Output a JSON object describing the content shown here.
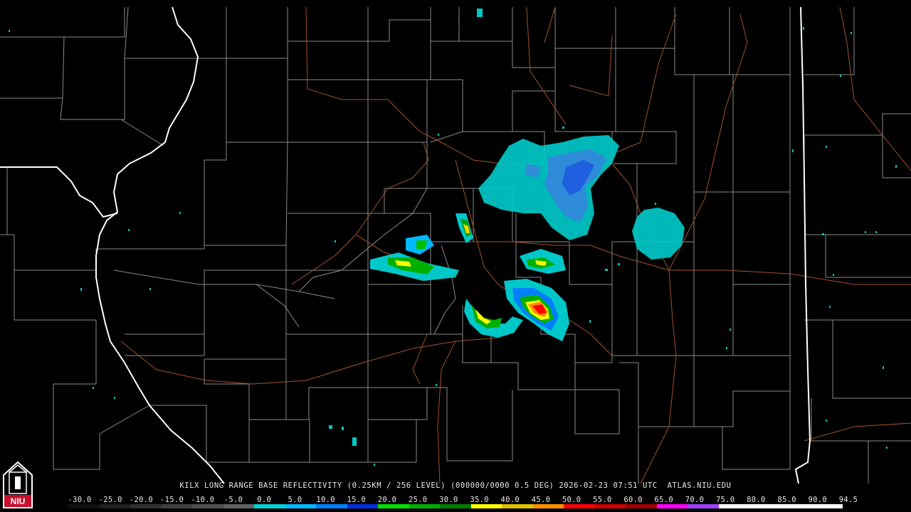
{
  "caption": "KILX LONG RANGE BASE REFLECTIVITY (0.25KM / 256 LEVEL) (000000/0000 0.5 DEG) 2026-02-23 07:51 UTC  ATLAS.NIU.EDU",
  "logo_text": "NIU",
  "scale": {
    "labels": [
      "-30.0",
      "-25.0",
      "-20.0",
      "-15.0",
      "-10.0",
      "-5.0",
      "0.0",
      "5.0",
      "10.0",
      "15.0",
      "20.0",
      "25.0",
      "30.0",
      "35.0",
      "40.0",
      "45.0",
      "50.0",
      "55.0",
      "60.0",
      "65.0",
      "70.0",
      "75.0",
      "80.0",
      "85.0",
      "90.0",
      "94.5"
    ],
    "colors": [
      "#101010",
      "#202020",
      "#303030",
      "#404040",
      "#505050",
      "#606060",
      "#00d0d0",
      "#00b8ff",
      "#0080ff",
      "#0030e0",
      "#00e000",
      "#00b000",
      "#008000",
      "#ffff00",
      "#e0c000",
      "#ff9000",
      "#ff0000",
      "#d00000",
      "#a00000",
      "#ff00ff",
      "#a040ff",
      "#ffffff",
      "#ffffff",
      "#ffffff",
      "#ffffff"
    ]
  },
  "colors": {
    "background": "#000000",
    "county_border": "#8a8a8a",
    "state_border": "#ffffff",
    "highway": "#a0522d"
  }
}
